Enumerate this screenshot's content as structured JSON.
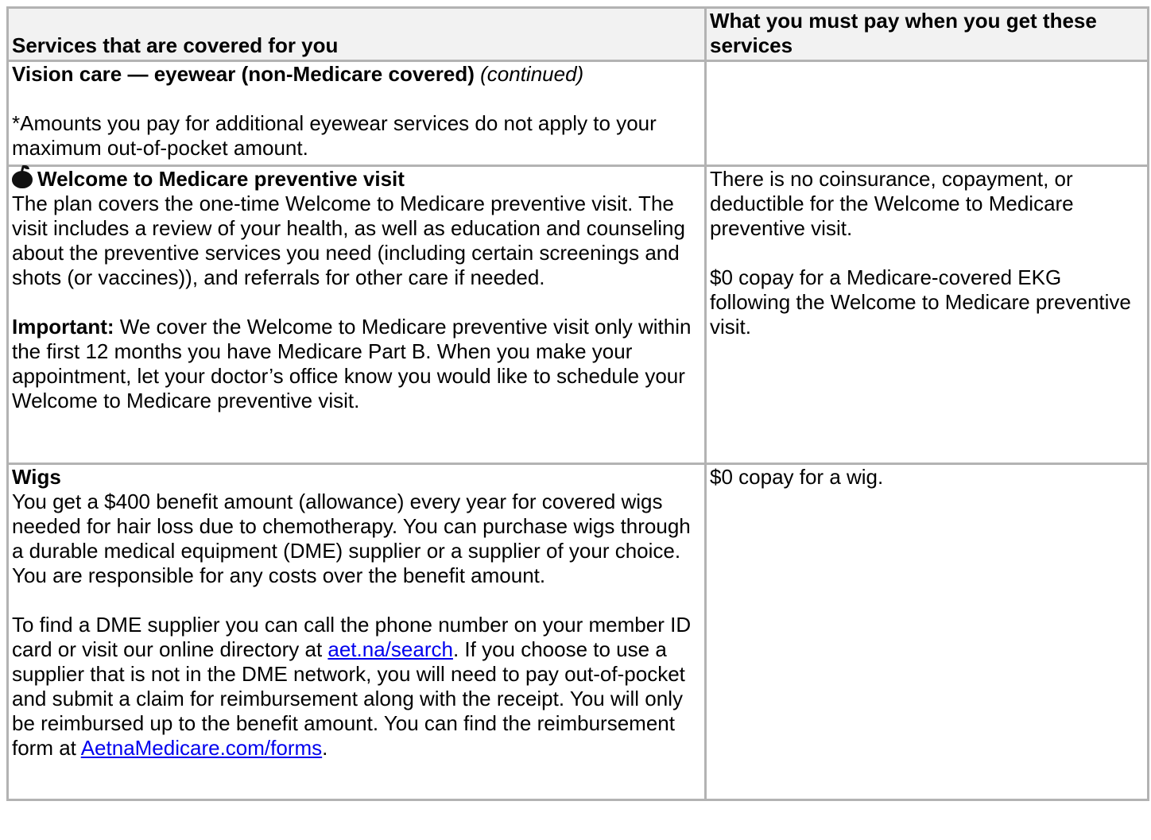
{
  "header": {
    "col1": "Services that are covered for you",
    "col2": "What you must pay when you get these services"
  },
  "rows": [
    {
      "title": "Vision care — eyewear (non-Medicare covered)",
      "title_suffix": "(continued)",
      "paragraphs": [
        "*Amounts you pay for additional eyewear services do not apply to your maximum out-of-pocket amount."
      ],
      "cost": []
    },
    {
      "icon": "apple-icon",
      "title": "Welcome to Medicare preventive visit",
      "intro": "The plan covers the one-time Welcome to Medicare preventive visit. The visit includes a review of your health, as well as education and counseling about the preventive services you need (including certain screenings and shots (or vaccines)), and referrals for other care if needed.",
      "important_label": "Important:",
      "important_text": " We cover the Welcome to Medicare preventive visit only within the first 12 months you have Medicare Part B. When you make your appointment, let your doctor’s office know you would like to schedule your Welcome to Medicare preventive visit.",
      "cost": [
        "There is no coinsurance, copayment, or deductible for the Welcome to Medicare preventive visit.",
        "$0 copay for a Medicare-covered EKG following the Welcome to Medicare preventive visit."
      ]
    },
    {
      "title": "Wigs",
      "intro": "You get a $400 benefit amount (allowance) every year for covered wigs needed for hair loss due to chemotherapy. You can purchase wigs through a durable medical equipment (DME) supplier or a supplier of your choice. You are responsible for any costs over the benefit amount.",
      "para2_a": "To find a DME supplier you can call the phone number on your member ID card or visit our online directory at ",
      "link1": "aet.na/search",
      "para2_b": ". If you choose to use a supplier that is not in the DME network, you will need to pay out-of-pocket and submit a claim for reimbursement along with the receipt. You will only be reimbursed up to the benefit amount. You can find the reimbursement form at ",
      "link2": "AetnaMedicare.com/forms",
      "para2_c": ".",
      "cost": [
        "$0 copay for a wig."
      ]
    }
  ]
}
